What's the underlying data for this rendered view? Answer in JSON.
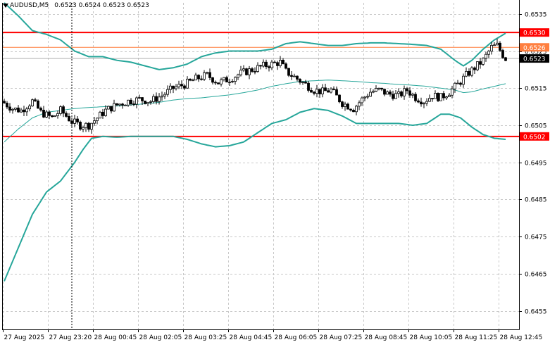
{
  "header": {
    "symbol_timeframe": "AUDUSD,M5",
    "ohlc_text": "0.6523 0.6524 0.6523 0.6523",
    "dropdown_icon": "triangle-down-icon"
  },
  "colors": {
    "background": "#ffffff",
    "grid": "#c8c8c8",
    "candle": "#000000",
    "bollinger_bands": "#26a69a",
    "level_lines": "#ff0000",
    "price_line": "#ff7f3f",
    "bid_line": "#b0b0b0",
    "axis_text": "#000000"
  },
  "chart_data": {
    "type": "candlestick",
    "title": "AUDUSD,M5",
    "ylim": [
      0.645,
      0.6538
    ],
    "y_ticks": [
      "0.6535",
      "0.6525",
      "0.6515",
      "0.6505",
      "0.6495",
      "0.6485",
      "0.6475",
      "0.6465",
      "0.6455"
    ],
    "y_tick_values": [
      0.6535,
      0.6525,
      0.6515,
      0.6505,
      0.6495,
      0.6485,
      0.6475,
      0.6465,
      0.6455
    ],
    "x_ticks": [
      "27 Aug 2025",
      "27 Aug 23:20",
      "28 Aug 00:45",
      "28 Aug 02:05",
      "28 Aug 03:25",
      "28 Aug 04:45",
      "28 Aug 06:05",
      "28 Aug 07:25",
      "28 Aug 08:45",
      "28 Aug 10:05",
      "28 Aug 11:25",
      "28 Aug 12:45"
    ],
    "x_tick_index": [
      0,
      16,
      32,
      48,
      64,
      80,
      96,
      112,
      128,
      144,
      160,
      176
    ],
    "bar_count": 179,
    "horizontal_levels": [
      {
        "price": 0.653,
        "label": "0.6530",
        "kind": "resistance"
      },
      {
        "price": 0.6502,
        "label": "0.6502",
        "kind": "support"
      }
    ],
    "price_tag": {
      "price": 0.6526,
      "label": "0.6526"
    },
    "bid_tag": {
      "price": 0.6523,
      "label": "0.6523"
    },
    "crosshair_index": 24,
    "close_anchors": [
      [
        0,
        0.6511
      ],
      [
        3,
        0.65095
      ],
      [
        6,
        0.6509
      ],
      [
        10,
        0.65115
      ],
      [
        13,
        0.65085
      ],
      [
        17,
        0.6507
      ],
      [
        20,
        0.6509
      ],
      [
        24,
        0.6506
      ],
      [
        27,
        0.6505
      ],
      [
        30,
        0.6505
      ],
      [
        33,
        0.6507
      ],
      [
        36,
        0.6509
      ],
      [
        40,
        0.65105
      ],
      [
        44,
        0.65115
      ],
      [
        48,
        0.6512
      ],
      [
        52,
        0.65115
      ],
      [
        56,
        0.6513
      ],
      [
        60,
        0.6515
      ],
      [
        64,
        0.6516
      ],
      [
        68,
        0.65175
      ],
      [
        72,
        0.65185
      ],
      [
        76,
        0.65165
      ],
      [
        80,
        0.65175
      ],
      [
        84,
        0.6519
      ],
      [
        88,
        0.652
      ],
      [
        92,
        0.6521
      ],
      [
        95,
        0.65215
      ],
      [
        98,
        0.6522
      ],
      [
        100,
        0.65195
      ],
      [
        103,
        0.6518
      ],
      [
        106,
        0.65165
      ],
      [
        110,
        0.65145
      ],
      [
        113,
        0.6514
      ],
      [
        116,
        0.65145
      ],
      [
        120,
        0.6511
      ],
      [
        124,
        0.65095
      ],
      [
        127,
        0.6512
      ],
      [
        130,
        0.6514
      ],
      [
        133,
        0.65145
      ],
      [
        136,
        0.65135
      ],
      [
        140,
        0.6513
      ],
      [
        143,
        0.65145
      ],
      [
        146,
        0.65125
      ],
      [
        149,
        0.65115
      ],
      [
        152,
        0.6513
      ],
      [
        155,
        0.65125
      ],
      [
        158,
        0.6514
      ],
      [
        161,
        0.6516
      ],
      [
        164,
        0.65185
      ],
      [
        167,
        0.65205
      ],
      [
        170,
        0.65225
      ],
      [
        173,
        0.6526
      ],
      [
        175,
        0.65265
      ],
      [
        177,
        0.6524
      ],
      [
        178,
        0.6523
      ]
    ],
    "bollinger_upper": [
      [
        0,
        0.6538
      ],
      [
        5,
        0.65345
      ],
      [
        10,
        0.65305
      ],
      [
        15,
        0.65295
      ],
      [
        20,
        0.6528
      ],
      [
        25,
        0.6525
      ],
      [
        30,
        0.65235
      ],
      [
        35,
        0.65235
      ],
      [
        40,
        0.65225
      ],
      [
        45,
        0.6522
      ],
      [
        50,
        0.6521
      ],
      [
        55,
        0.652
      ],
      [
        60,
        0.65205
      ],
      [
        65,
        0.65215
      ],
      [
        70,
        0.65235
      ],
      [
        75,
        0.65245
      ],
      [
        80,
        0.6525
      ],
      [
        85,
        0.6525
      ],
      [
        90,
        0.6525
      ],
      [
        95,
        0.65255
      ],
      [
        100,
        0.6527
      ],
      [
        105,
        0.65275
      ],
      [
        110,
        0.6527
      ],
      [
        115,
        0.65265
      ],
      [
        120,
        0.65265
      ],
      [
        125,
        0.6527
      ],
      [
        130,
        0.65272
      ],
      [
        135,
        0.65272
      ],
      [
        140,
        0.6527
      ],
      [
        145,
        0.65268
      ],
      [
        150,
        0.65265
      ],
      [
        155,
        0.65255
      ],
      [
        160,
        0.65225
      ],
      [
        163,
        0.6521
      ],
      [
        166,
        0.65225
      ],
      [
        170,
        0.65255
      ],
      [
        174,
        0.6528
      ],
      [
        178,
        0.65298
      ]
    ],
    "bollinger_middle": [
      [
        0,
        0.65005
      ],
      [
        5,
        0.6504
      ],
      [
        10,
        0.6507
      ],
      [
        15,
        0.65085
      ],
      [
        20,
        0.6509
      ],
      [
        25,
        0.65095
      ],
      [
        30,
        0.65098
      ],
      [
        35,
        0.651
      ],
      [
        40,
        0.65102
      ],
      [
        45,
        0.65105
      ],
      [
        50,
        0.65108
      ],
      [
        55,
        0.65112
      ],
      [
        60,
        0.65118
      ],
      [
        65,
        0.65122
      ],
      [
        70,
        0.65124
      ],
      [
        75,
        0.65128
      ],
      [
        80,
        0.65132
      ],
      [
        85,
        0.65138
      ],
      [
        90,
        0.65145
      ],
      [
        95,
        0.65155
      ],
      [
        100,
        0.65162
      ],
      [
        105,
        0.65168
      ],
      [
        110,
        0.6517
      ],
      [
        115,
        0.65172
      ],
      [
        120,
        0.6517
      ],
      [
        125,
        0.65168
      ],
      [
        130,
        0.65165
      ],
      [
        135,
        0.65163
      ],
      [
        140,
        0.6516
      ],
      [
        145,
        0.65158
      ],
      [
        150,
        0.65155
      ],
      [
        155,
        0.6515
      ],
      [
        160,
        0.65145
      ],
      [
        163,
        0.65138
      ],
      [
        166,
        0.6514
      ],
      [
        170,
        0.65148
      ],
      [
        174,
        0.65155
      ],
      [
        178,
        0.65162
      ]
    ],
    "bollinger_lower": [
      [
        0,
        0.6463
      ],
      [
        5,
        0.6472
      ],
      [
        10,
        0.6481
      ],
      [
        15,
        0.6487
      ],
      [
        20,
        0.649
      ],
      [
        25,
        0.6495
      ],
      [
        28,
        0.64985
      ],
      [
        31,
        0.65015
      ],
      [
        35,
        0.6502
      ],
      [
        40,
        0.65018
      ],
      [
        45,
        0.6502
      ],
      [
        50,
        0.6502
      ],
      [
        55,
        0.6502
      ],
      [
        60,
        0.6502
      ],
      [
        65,
        0.65012
      ],
      [
        70,
        0.65
      ],
      [
        75,
        0.64992
      ],
      [
        80,
        0.64995
      ],
      [
        85,
        0.65005
      ],
      [
        90,
        0.6503
      ],
      [
        95,
        0.65055
      ],
      [
        100,
        0.65065
      ],
      [
        105,
        0.65085
      ],
      [
        110,
        0.65095
      ],
      [
        115,
        0.6509
      ],
      [
        120,
        0.65075
      ],
      [
        125,
        0.65055
      ],
      [
        130,
        0.65055
      ],
      [
        135,
        0.65055
      ],
      [
        140,
        0.65055
      ],
      [
        145,
        0.6505
      ],
      [
        150,
        0.65055
      ],
      [
        155,
        0.6508
      ],
      [
        158,
        0.6508
      ],
      [
        162,
        0.6507
      ],
      [
        166,
        0.65045
      ],
      [
        170,
        0.65025
      ],
      [
        174,
        0.65015
      ],
      [
        178,
        0.65012
      ]
    ]
  }
}
